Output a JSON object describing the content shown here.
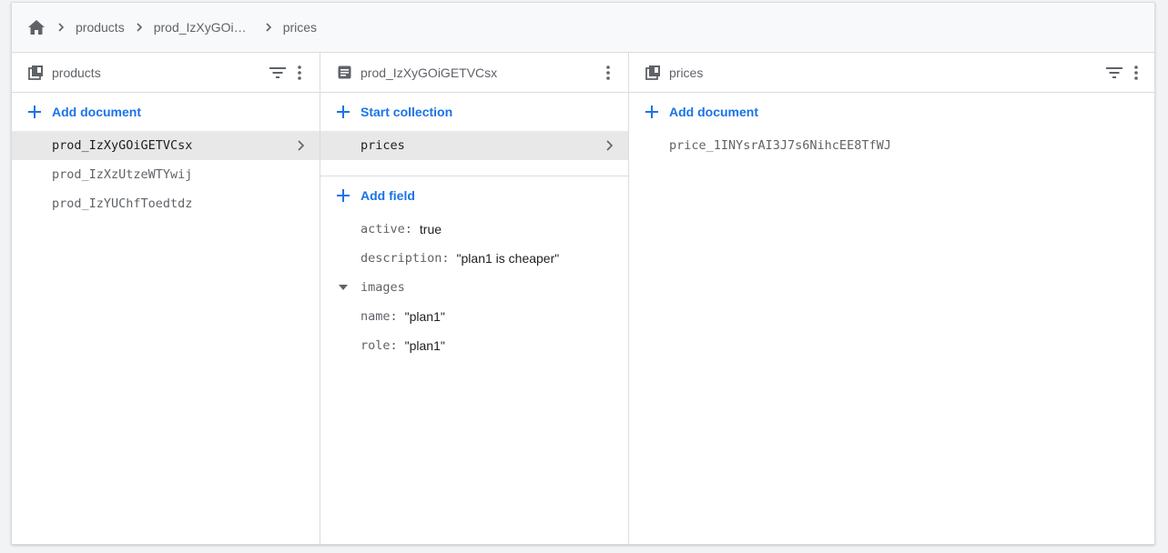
{
  "breadcrumb": {
    "home_icon": "home-icon",
    "items": [
      "products",
      "prod_IzXyGOiGETVCsx",
      "prices"
    ]
  },
  "colors": {
    "accent": "#1a73e8",
    "muted_text": "#5f6368",
    "selected_row": "#e8e8e8",
    "border": "#dadce0"
  },
  "panels": {
    "products": {
      "icon": "collection-icon",
      "title": "products",
      "action_label": "Add document",
      "items": [
        "prod_IzXyGOiGETVCsx",
        "prod_IzXzUtzeWTYwij",
        "prod_IzYUChfToedtdz"
      ],
      "selected_index": 0
    },
    "document": {
      "icon": "document-icon",
      "title": "prod_IzXyGOiGETVCsx",
      "collection_action_label": "Start collection",
      "collections": [
        "prices"
      ],
      "field_action_label": "Add field",
      "fields": [
        {
          "key": "active",
          "value": "true"
        },
        {
          "key": "description",
          "value": "\"plan1 is cheaper\""
        }
      ],
      "map_field": {
        "key": "images",
        "children": [
          {
            "key": "name",
            "value": "\"plan1\""
          },
          {
            "key": "role",
            "value": "\"plan1\""
          }
        ]
      }
    },
    "prices": {
      "icon": "collection-icon",
      "title": "prices",
      "action_label": "Add document",
      "items": [
        "price_1INYsrAI3J7s6NihcEE8TfWJ"
      ]
    }
  }
}
